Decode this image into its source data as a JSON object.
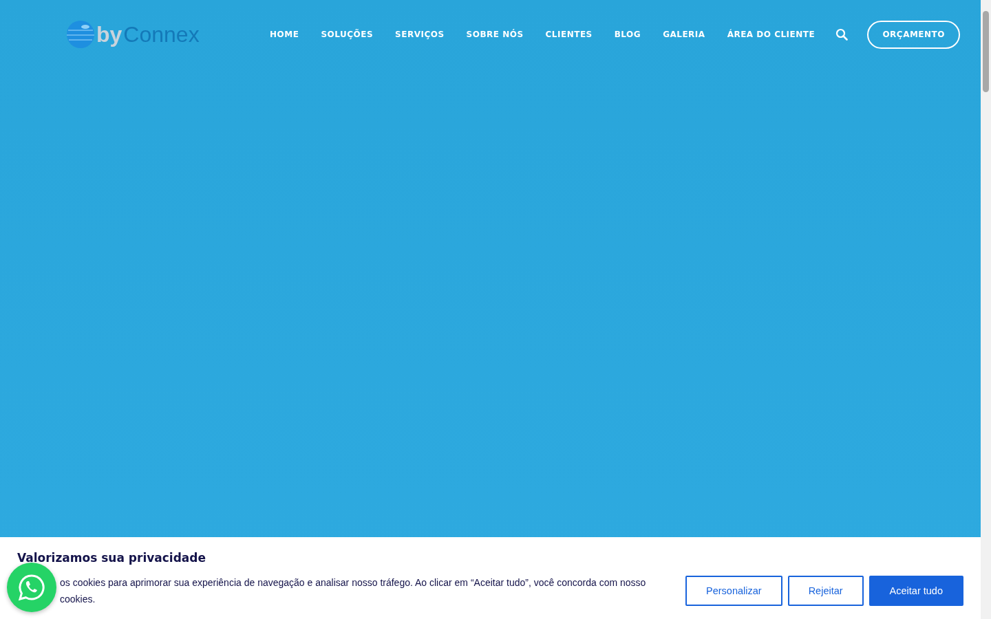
{
  "header": {
    "logo": {
      "part_1": "by",
      "part_2": "Connex"
    },
    "nav": [
      {
        "label": "HOME"
      },
      {
        "label": "SOLUÇÕES"
      },
      {
        "label": "SERVIÇOS"
      },
      {
        "label": "SOBRE NÓS"
      },
      {
        "label": "CLIENTES"
      },
      {
        "label": "BLOG"
      },
      {
        "label": "GALERIA"
      },
      {
        "label": "ÁREA DO CLIENTE"
      }
    ],
    "cta": "ORÇAMENTO"
  },
  "cookie_banner": {
    "title": "Valorizamos sua privacidade",
    "text_lines": [
      "os cookies para aprimorar sua experiência de navegação e analisar nosso tráfego. Ao clicar em “Aceitar tudo”, você concorda com nosso",
      "cookies."
    ],
    "buttons": [
      {
        "label": "Personalizar",
        "kind": "outline"
      },
      {
        "label": "Rejeitar",
        "kind": "outline"
      },
      {
        "label": "Aceitar tudo",
        "kind": "primary"
      }
    ]
  }
}
